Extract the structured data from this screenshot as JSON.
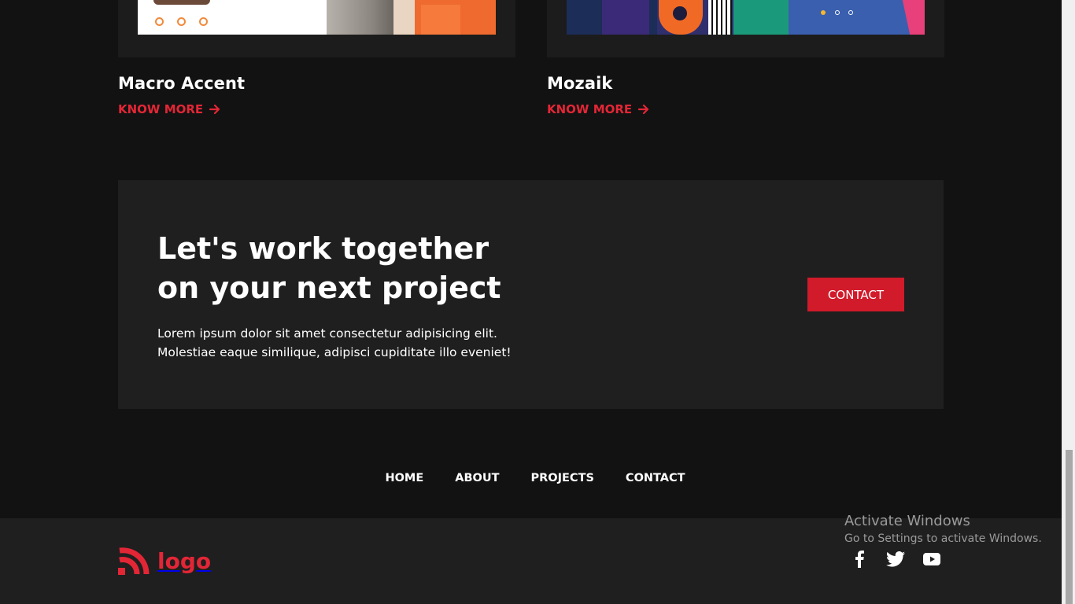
{
  "projects": [
    {
      "title": "Macro Accent",
      "link_label": "KNOW MORE"
    },
    {
      "title": "Mozaik",
      "link_label": "KNOW MORE"
    }
  ],
  "cta": {
    "heading_line1": "Let's work together",
    "heading_line2": "on your next project",
    "text_line1": "Lorem ipsum dolor sit amet consectetur adipisicing elit.",
    "text_line2": "Molestiae eaque similique, adipisci cupiditate illo eveniet!",
    "button_label": "CONTACT"
  },
  "footer_nav": [
    "HOME",
    "ABOUT",
    "PROJECTS",
    "CONTACT"
  ],
  "footer": {
    "logo_text": "logo",
    "socials": [
      "facebook-icon",
      "twitter-icon",
      "youtube-icon"
    ]
  },
  "windows_watermark": {
    "title": "Activate Windows",
    "subtitle": "Go to Settings to activate Windows."
  },
  "colors": {
    "accent": "#e32636",
    "button": "#d11a2a",
    "background": "#121212",
    "panel": "#1f1f1f"
  }
}
